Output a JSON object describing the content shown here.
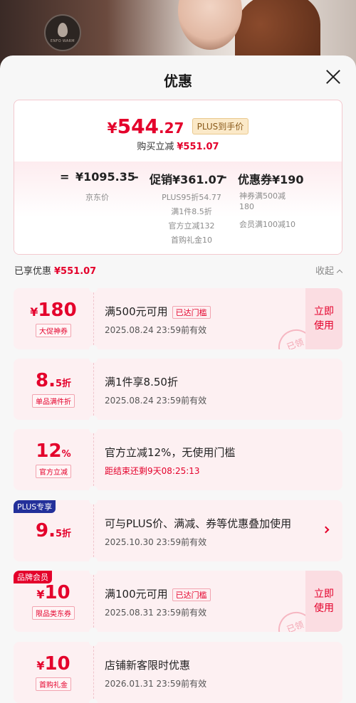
{
  "background": {
    "logo_text": "ENFO WARM"
  },
  "sheet": {
    "title": "优惠"
  },
  "summary": {
    "price_yen": "¥",
    "price_int": "544",
    "price_dec": ".27",
    "price_tag": "PLUS到手价",
    "buy_label": "购买立减",
    "buy_amount": "¥551.07",
    "formula": {
      "eq": "=",
      "jd_price": "¥1095.35",
      "minus1": "-",
      "promo": "促销¥361.07",
      "minus2": "-",
      "coupon": "优惠券¥190"
    },
    "col1": [
      "京东价"
    ],
    "col2": [
      "PLUS95折54.77",
      "满1件8.5折",
      "官方立减132",
      "首购礼金10"
    ],
    "col3": [
      "神券满500减",
      "180",
      "会员满100减10"
    ]
  },
  "enjoyed": {
    "label": "已享优惠",
    "amount": "¥551.07",
    "collapse": "收起"
  },
  "coupons": [
    {
      "cur": "¥",
      "num": "180",
      "sm": "",
      "tag": "大促神券",
      "title": "满500元可用",
      "reached": "已达门槛",
      "sub": "2025.08.24  23:59前有效",
      "use": "立即使用",
      "stamp": "已领"
    },
    {
      "cur": "",
      "num": "8.",
      "sm": "5折",
      "tag": "单品满件折",
      "title": "满1件享8.50折",
      "sub": "2025.08.24  23:59前有效"
    },
    {
      "cur": "",
      "num": "12",
      "sm": "%",
      "tag": "官方立减",
      "title": "官方立减12%，无使用门槛",
      "sub": "距结束还剩9天08:25:13"
    },
    {
      "badge": "PLUS专享",
      "cur": "",
      "num": "9.",
      "sm": "5折",
      "title": "可与PLUS价、满减、券等优惠叠加使用",
      "sub": "2025.10.30  23:59前有效"
    },
    {
      "badge": "品牌会员",
      "cur": "¥",
      "num": "10",
      "sm": "",
      "tag": "限品类东券",
      "title": "满100元可用",
      "reached": "已达门槛",
      "sub": "2025.08.31  23:59前有效",
      "use": "立即使用",
      "stamp": "已领"
    },
    {
      "cur": "¥",
      "num": "10",
      "sm": "",
      "tag": "首购礼金",
      "title": "店铺新客限时优惠",
      "sub": "2026.01.31  23:59前有效"
    }
  ],
  "colors": {
    "accent": "#e4002b",
    "plus_badge": "#23309a"
  }
}
